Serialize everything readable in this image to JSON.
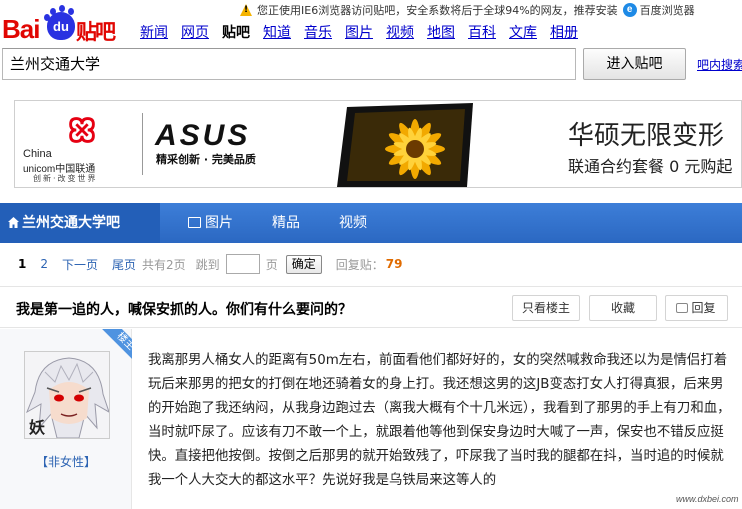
{
  "notice": {
    "text": "您正使用IE6浏览器访问贴吧，安全系数将后于全球94%的网友，推荐安装",
    "browser_link": "百度浏览器"
  },
  "logo": {
    "bai": "Bai",
    "du": "du",
    "tieba": "贴吧"
  },
  "nav": [
    "新闻",
    "网页",
    "贴吧",
    "知道",
    "音乐",
    "图片",
    "视频",
    "地图",
    "百科",
    "文库",
    "相册"
  ],
  "search": {
    "value": "兰州交通大学",
    "button": "进入贴吧",
    "inner_link": "吧内搜索"
  },
  "banner": {
    "cu_name_en_1": "China",
    "cu_name_en_2": "unicom中国联通",
    "cu_slogan": "创新·改变世界",
    "brand": "ASUS",
    "brand_slogan": "精采创新 · 完美品质",
    "title": "华硕无限变形",
    "subtitle": "联通合约套餐 0 元购起"
  },
  "forum_nav": {
    "home": "兰州交通大学吧",
    "pics": "图片",
    "featured": "精品",
    "video": "视频"
  },
  "pager": {
    "current": "1",
    "page2": "2",
    "next": "下一页",
    "last": "尾页",
    "total": "共有2页",
    "jump": "跳到",
    "page_unit": "页",
    "ok": "确定",
    "reply_label": "回复贴：",
    "reply_count": "79"
  },
  "thread": {
    "title": "我是第一追的人，喊保安抓的人。你们有什么要问的？",
    "only_op": "只看楼主",
    "favorite": "收藏",
    "reply": "回复"
  },
  "post": {
    "badge": "楼主",
    "avatar_char": "妖",
    "username": "【非女性】",
    "body": "我离那男人桶女人的距离有50m左右，前面看他们都好好的，女的突然喊救命我还以为是情侣打着玩后来那男的把女的打倒在地还骑着女的身上打。我还想这男的这JB变态打女人打得真狠，后来男的开始跑了我还纳闷，从我身边跑过去（离我大概有个十几米远），我看到了那男的手上有刀和血，当时就吓尿了。应该有刀不敢一个上，就跟着他等他到保安身边时大喊了一声，保安也不错反应挺快。直接把他按倒。按倒之后那男的就开始致残了，吓尿我了当时我的腿都在抖，当时追的时候就我一个人大交大的都这水平？先说好我是乌铁局来这等人的"
  },
  "watermark": "www.dxbei.com"
}
